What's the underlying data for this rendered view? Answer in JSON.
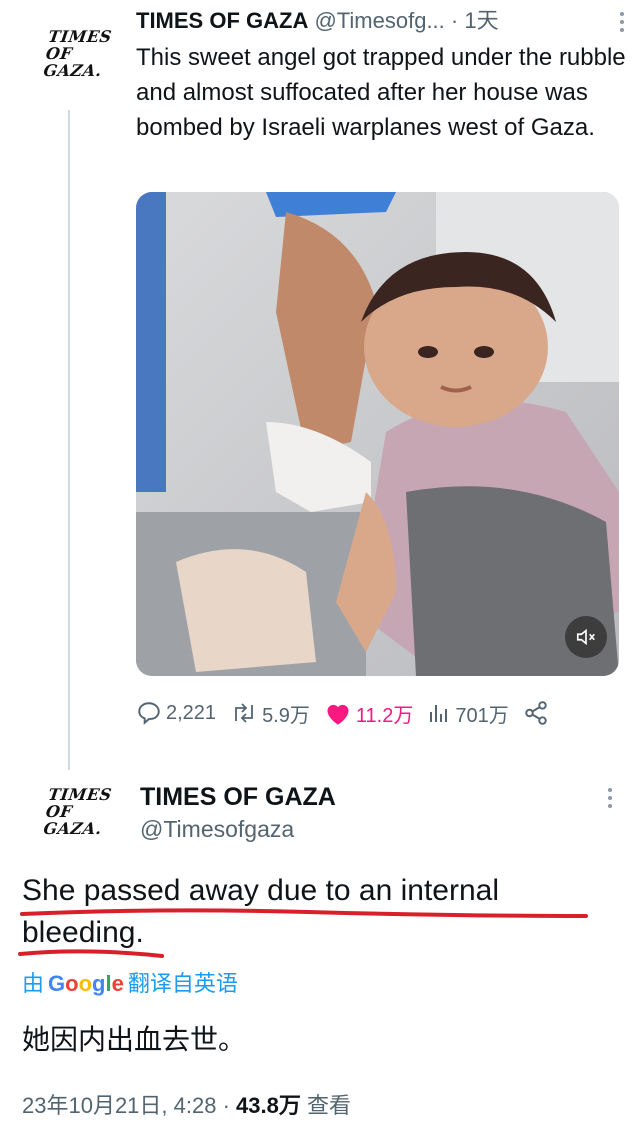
{
  "tweet1": {
    "avatar_text": [
      "TIMES",
      "OF",
      "GAZA."
    ],
    "name": "TIMES OF GAZA",
    "handle": "@Timesofg...",
    "time": "· 1天",
    "text": "This sweet angel got trapped under the rubble and almost suffocated after her house was bombed by Israeli warplanes west of Gaza.",
    "media": {
      "muted_icon": "speaker-muted-icon"
    },
    "actions": {
      "replies": "2,221",
      "retweets": "5.9万",
      "likes": "11.2万",
      "views": "701万"
    }
  },
  "tweet2": {
    "avatar_text": [
      "TIMES",
      "OF",
      "GAZA."
    ],
    "name": "TIMES OF GAZA",
    "handle": "@Timesofgaza",
    "text": "She passed away due to an internal bleeding.",
    "translate_prefix": "由",
    "translate_google": "Google",
    "translate_suffix": "翻译自英语",
    "translated_text": "她因内出血去世。",
    "date": "23年10月21日, 4:28 ·",
    "views_count": "43.8万",
    "views_label": "查看"
  },
  "colors": {
    "accent": "#1d9bf0",
    "like": "#f91880",
    "underline": "#d8202a",
    "secondary": "#536471"
  }
}
